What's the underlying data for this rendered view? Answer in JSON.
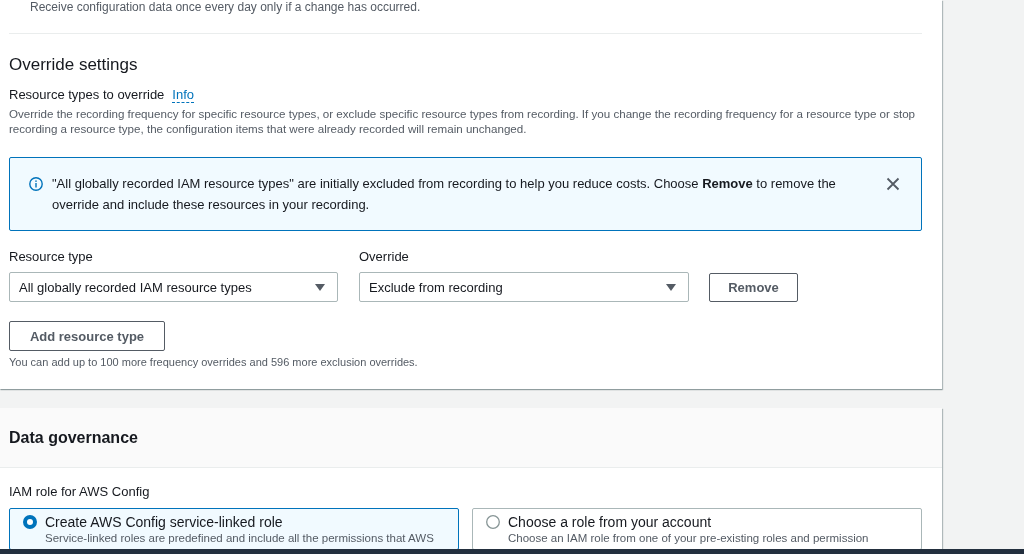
{
  "recording_option": {
    "description": "Receive configuration data once every day only if a change has occurred."
  },
  "override_settings": {
    "title": "Override settings",
    "field_label": "Resource types to override",
    "info_link": "Info",
    "description": "Override the recording frequency for specific resource types, or exclude specific resource types from recording. If you change the recording frequency for a resource type or stop recording a resource type, the configuration items that were already recorded will remain unchanged.",
    "alert": {
      "text": "\"All globally recorded IAM resource types\" are initially excluded from recording to help you reduce costs. Choose **Remove** to remove the override and include these resources in your recording."
    },
    "columns": [
      "Resource type",
      "Override"
    ],
    "overrides": [
      {
        "resource_type": "All globally recorded IAM resource types",
        "override": "Exclude from recording",
        "remove_button": "Remove"
      }
    ],
    "add_button": "Add resource type",
    "hint": "You can add up to 100 more frequency overrides and 596 more exclusion overrides."
  },
  "data_governance": {
    "title": "Data governance",
    "field_label": "IAM role for AWS Config",
    "options": [
      {
        "label": "Create AWS Config service-linked role",
        "description": "Service-linked roles are predefined and include all the permissions that AWS",
        "selected": true
      },
      {
        "label": "Choose a role from your account",
        "description": "Choose an IAM role from one of your pre-existing roles and permission",
        "selected": false
      }
    ]
  }
}
